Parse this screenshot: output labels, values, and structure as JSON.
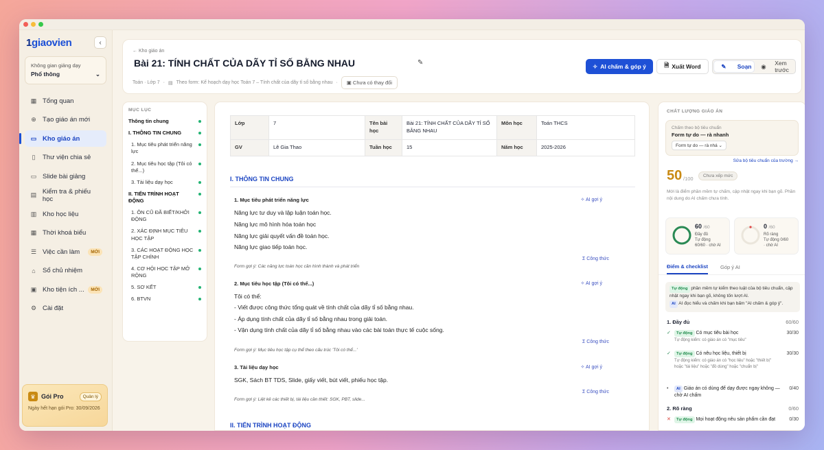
{
  "window": {
    "dot_colors": [
      "#f25f58",
      "#f7bd3b",
      "#36c84a"
    ]
  },
  "sidebar": {
    "logo_num": "1",
    "logo_text": "giaovien",
    "collapse_icon": "chevron-left-icon",
    "space_label": "Không gian giảng dạy",
    "space_value": "Phổ thông",
    "items": [
      {
        "label": "Tổng quan",
        "icon": "grid-icon"
      },
      {
        "label": "Tạo giáo án mới",
        "icon": "plus-circle-icon"
      },
      {
        "label": "Kho giáo án",
        "icon": "folder-icon",
        "active": true
      },
      {
        "label": "Thư viện chia sẻ",
        "icon": "document-icon"
      },
      {
        "label": "Slide bài giảng",
        "icon": "slide-icon"
      },
      {
        "label": "Kiểm tra & phiếu học",
        "icon": "clipboard-icon"
      },
      {
        "label": "Kho học liệu",
        "icon": "books-icon"
      },
      {
        "label": "Thời khoá biểu",
        "icon": "calendar-icon"
      },
      {
        "label": "Việc cần làm",
        "icon": "list-icon",
        "badge": "MỚI"
      },
      {
        "label": "Sổ chủ nhiệm",
        "icon": "graduation-cap-icon"
      },
      {
        "label": "Kho tiện ích ...",
        "icon": "gift-icon",
        "badge": "MỚI"
      },
      {
        "label": "Cài đặt",
        "icon": "gear-icon"
      }
    ],
    "pro": {
      "name": "Gói Pro",
      "manage": "Quản lý",
      "expiry": "Ngày hết hạn gói Pro: 30/09/2026"
    }
  },
  "header": {
    "breadcrumb": "← Kho giáo án",
    "title": "Bài 21: TÍNH CHẤT CỦA DÃY TỈ SỐ BẰNG NHAU",
    "meta_class": "Toán · Lớp 7",
    "meta_form": "Theo form: Kế hoạch dạy học Toán 7 – Tính chất của dãy tỉ số bằng nhau",
    "unchanged": "Chưa có thay đổi",
    "ai_button": "AI chấm & góp ý",
    "word_button": "Xuất Word",
    "edit_mode": "Soạn",
    "preview_mode": "Xem trước"
  },
  "toc": {
    "heading": "MỤC LỤC",
    "items": [
      {
        "label": "Thông tin chung",
        "bold": true
      },
      {
        "label": "I. THÔNG TIN CHUNG",
        "bold": true
      },
      {
        "label": "1. Mục tiêu phát triển năng lực"
      },
      {
        "label": "2. Mục tiêu học tập (Tôi có thể...)"
      },
      {
        "label": "3. Tài liệu dạy học"
      },
      {
        "label": "II. TIẾN TRÌNH HOẠT ĐỘNG",
        "bold": true
      },
      {
        "label": "1. ÔN CŨ ĐÃ BIẾT/KHỞI ĐỘNG"
      },
      {
        "label": "2. XÁC ĐỊNH MỤC TIÊU HỌC TẬP"
      },
      {
        "label": "3. CÁC HOẠT ĐỘNG HỌC TẬP CHÍNH"
      },
      {
        "label": "4. CƠ HỘI HỌC TẬP MỞ RỘNG"
      },
      {
        "label": "5. SƠ KẾT"
      },
      {
        "label": "6. BTVN"
      }
    ]
  },
  "doc": {
    "info": {
      "lop_k": "Lớp",
      "lop_v": "7",
      "bai_k": "Tên bài học",
      "bai_v": "Bài 21: TÍNH CHẤT CỦA DÃY TỈ SỐ BẰNG NHAU",
      "mon_k": "Môn học",
      "mon_v": "Toán THCS",
      "gv_k": "GV",
      "gv_v": "Lê Gia Thao",
      "tuan_k": "Tuần học",
      "tuan_v": "15",
      "nam_k": "Năm học",
      "nam_v": "2025-2026"
    },
    "section1": "I. THÔNG TIN CHUNG",
    "section2": "II. TIẾN TRÌNH HOẠT ĐỘNG",
    "ai_tip": "AI gợi ý",
    "formula": "Σ Công thức",
    "f1_title": "1. Mục tiêu phát triển năng lực",
    "f1_lines": [
      "Năng lực tư duy và lập luận toán học.",
      "Năng lực mô hình hóa toán học",
      "Năng lực giải quyết vấn đề toán học.",
      "Năng lực giao tiếp toán học."
    ],
    "f1_hint": "Form gợi ý: Các năng lực toán học cần hình thành và phát triển",
    "f2_title": "2. Mục tiêu học tập (Tôi có thể...)",
    "f2_lines": [
      "Tôi có thể:",
      "- Viết được công thức tổng quát về tính chất của dãy tỉ số bằng nhau.",
      "- Áp dụng tính chất của dãy tỉ số bằng nhau trong giải toán.",
      "- Vận dụng tính chất của dãy tỉ số bằng nhau vào các bài toán thực tế cuộc sống."
    ],
    "f2_hint": "Form gợi ý: Mục tiêu học tập cụ thể theo cấu trúc 'Tôi có thể...'",
    "f3_title": "3. Tài liệu dạy học",
    "f3_lines": [
      "SGK, Sách BT TDS, Slide, giấy viết, bút viết, phiếu học tập."
    ],
    "f3_hint": "Form gợi ý: Liệt kê các thiết bị, tài liệu cần thiết: SGK, PBT, slide..."
  },
  "quality": {
    "heading": "CHẤT LƯỢNG GIÁO ÁN",
    "crit_label": "Chấm theo bộ tiêu chuẩn",
    "crit_value": "Form tự do — rà nhanh",
    "crit_select": "Form tự do — rà nhá ⌄",
    "edit_criteria": "Sửa bộ tiêu chuẩn của trường →",
    "score": "50",
    "score_max": "/100",
    "score_badge": "Chưa xếp mức",
    "score_desc": "Mới là điểm phần mềm tự chấm, cập nhật ngay khi bạn gõ. Phần nội dung do AI chấm chưa tính.",
    "auto": {
      "num": "60",
      "max": "/60",
      "line1": "Đầy đủ",
      "line2": "Tự động",
      "line3": "60/60 · chờ AI",
      "fraction": 1.0,
      "color": "#2a8a55"
    },
    "clarity": {
      "num": "0",
      "max": "/60",
      "line1": "Rõ ràng",
      "line2": "Tự động 0/60",
      "line3": "· chờ AI",
      "fraction": 0.0,
      "color": "#e04848"
    },
    "tab_checklist": "Điểm & checklist",
    "tab_ai": "Góp ý AI",
    "note_auto_tag": "Tự động",
    "note_auto_text": "phần mềm tự kiểm theo luật của bộ tiêu chuẩn, cập nhật ngay khi bạn gõ, không tốn lượt AI.",
    "note_ai_tag": "AI",
    "note_ai_text": "AI đọc hiểu và chấm khi bạn bấm \"AI chấm & góp ý\".",
    "group1": {
      "title": "1. Đầy đủ",
      "score": "60/60"
    },
    "checks": [
      {
        "mark": "✓",
        "tag": "Tự động",
        "title": "Có mục tiêu bài học",
        "pts": "30/30",
        "sub": "Tự động kiểm: có giáo án có \"mục tiêu\"",
        "status": "pass"
      },
      {
        "mark": "✓",
        "tag": "Tự động",
        "title": "Có nêu học liệu, thiết bị",
        "pts": "30/30",
        "sub": "Tự động kiểm: có giáo án có \"học liệu\" hoặc \"thiết bị\" hoặc \"tài liệu\" hoặc \"đồ dùng\" hoặc \"chuẩn bị\"",
        "status": "pass"
      },
      {
        "mark": "•",
        "tag": "AI",
        "title": "Giáo án có dùng để dạy được ngay không — chờ AI chấm",
        "pts": "0/40",
        "sub": "",
        "status": "pending"
      }
    ],
    "group2": {
      "title": "2. Rõ ràng",
      "score": "0/60"
    },
    "check_fail": {
      "mark": "✕",
      "tag": "Tự động",
      "title": "Mọi hoạt động nêu sản phẩm cần đạt",
      "pts": "0/30",
      "status": "fail"
    }
  }
}
